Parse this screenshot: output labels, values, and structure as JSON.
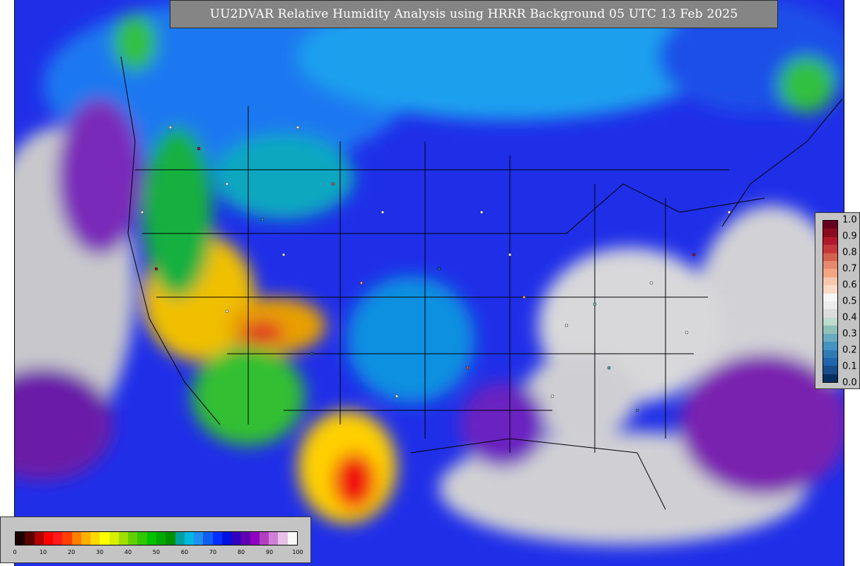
{
  "title": "UU2DVAR Relative Humidity Analysis using HRRR Background 05 UTC 13 Feb 2025",
  "rh_colorbar": {
    "ticks": [
      "0",
      "10",
      "20",
      "30",
      "40",
      "50",
      "60",
      "70",
      "80",
      "90",
      "100"
    ],
    "colors": [
      "#1a0000",
      "#5a0000",
      "#b20000",
      "#ff0000",
      "#ff1a1a",
      "#ff4000",
      "#ff8000",
      "#ffb000",
      "#ffd800",
      "#ffff00",
      "#d8f000",
      "#a0e000",
      "#60d000",
      "#30c800",
      "#00c000",
      "#00a800",
      "#009000",
      "#00a0a0",
      "#00b8e0",
      "#2090f0",
      "#1060f0",
      "#0030ff",
      "#0010e0",
      "#3000c0",
      "#6000b0",
      "#9000c0",
      "#b040c0",
      "#d080d8",
      "#e8c0e8",
      "#f8f8f8"
    ]
  },
  "fraction_colorbar": {
    "ticks": [
      "1.0",
      "0.9",
      "0.8",
      "0.7",
      "0.6",
      "0.5",
      "0.4",
      "0.3",
      "0.2",
      "0.1",
      "0.0"
    ],
    "colors": [
      "#67001f",
      "#8b0a1c",
      "#b2182b",
      "#c8373a",
      "#d6604d",
      "#e6886e",
      "#f4a582",
      "#f8c8ae",
      "#fddbc7",
      "#f7f7f7",
      "#ececec",
      "#dcdcdc",
      "#bcdcd0",
      "#8fc1b8",
      "#6aaac0",
      "#4393c3",
      "#2f79b5",
      "#2166ac",
      "#174e8a",
      "#053061"
    ]
  }
}
